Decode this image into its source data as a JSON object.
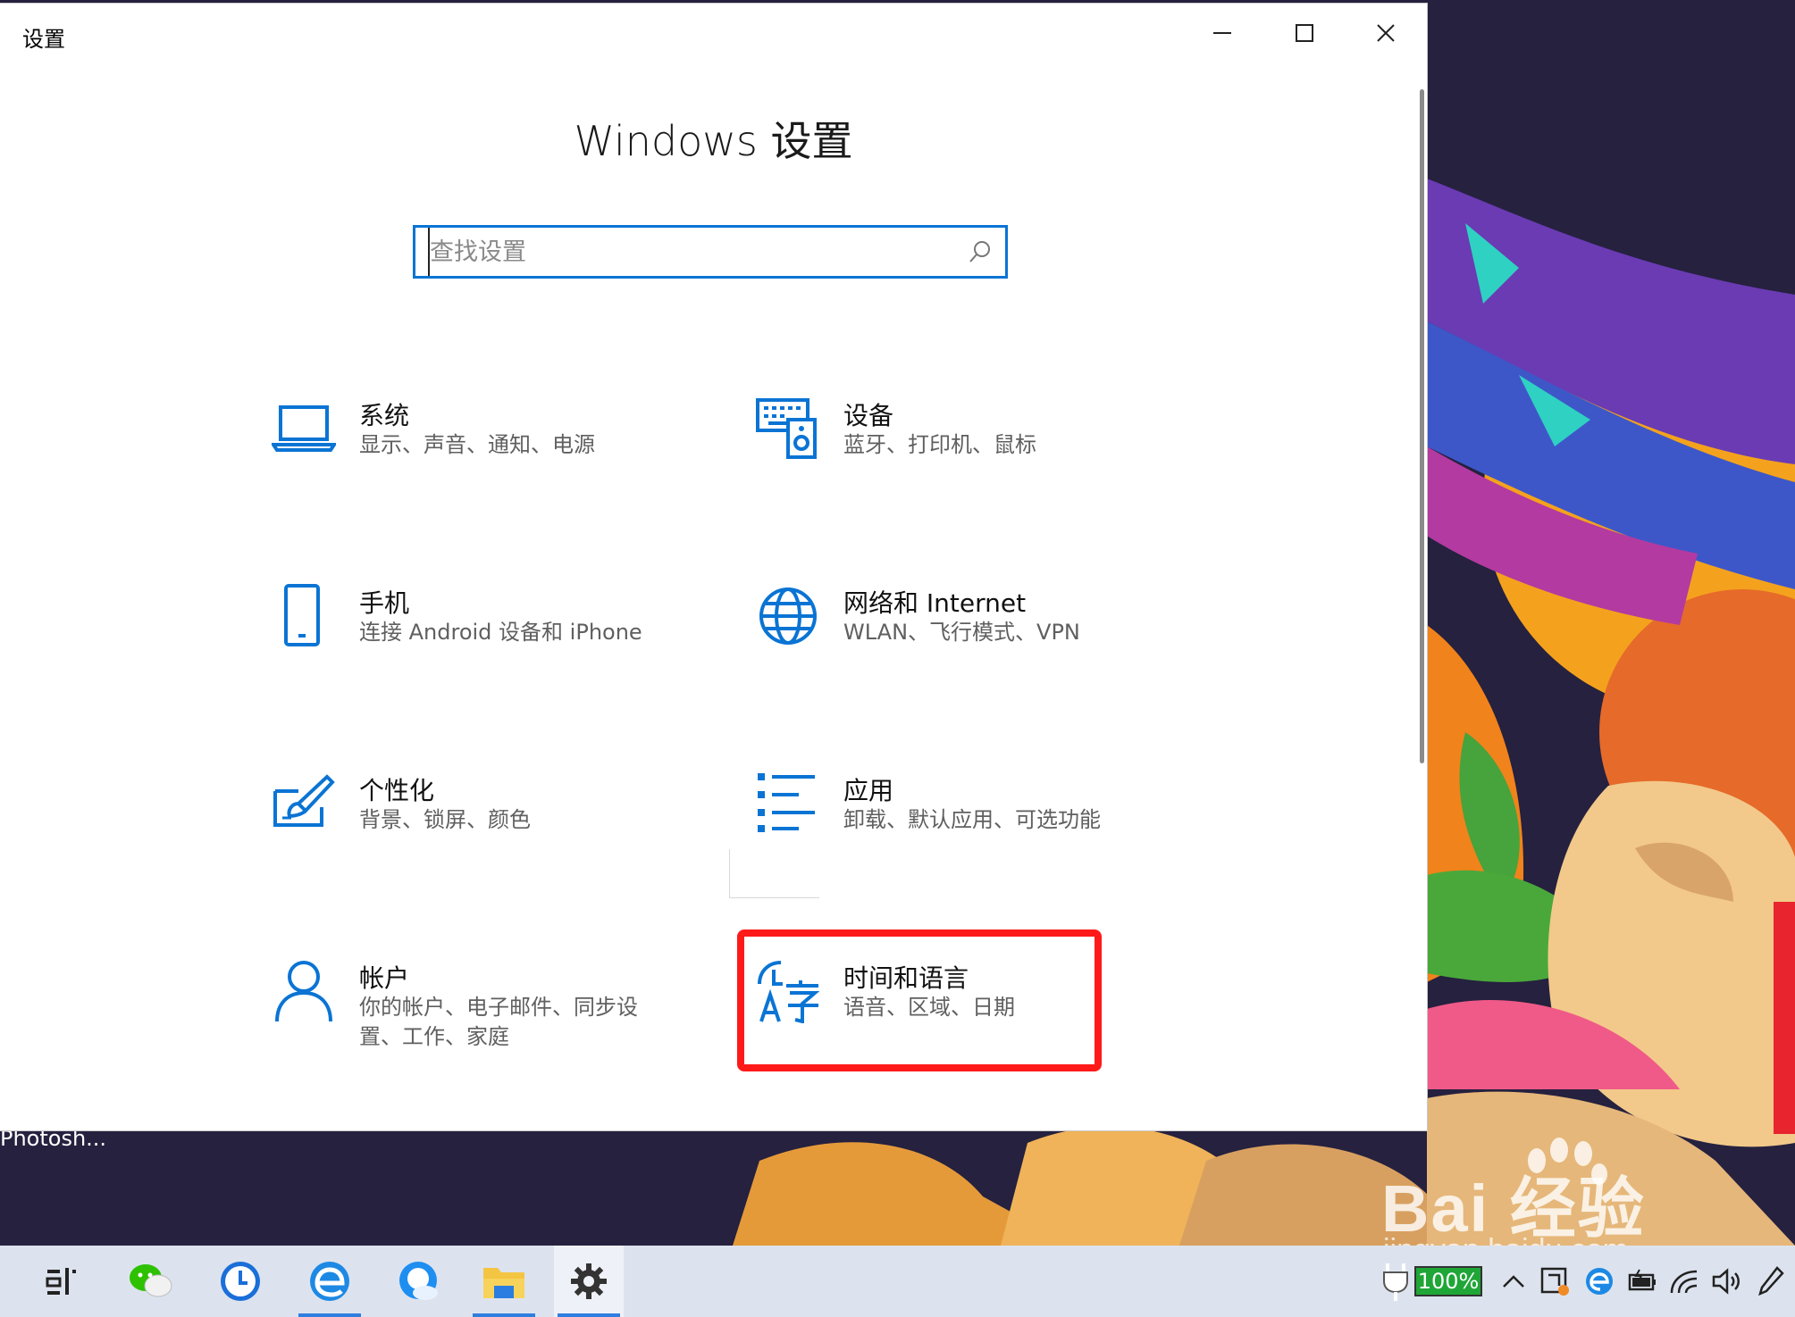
{
  "window": {
    "title": "设置",
    "heading": "Windows 设置"
  },
  "search": {
    "placeholder": "查找设置"
  },
  "tiles": [
    {
      "title": "系统",
      "desc": "显示、声音、通知、电源",
      "icon": "laptop-icon"
    },
    {
      "title": "设备",
      "desc": "蓝牙、打印机、鼠标",
      "icon": "devices-icon"
    },
    {
      "title": "手机",
      "desc": "连接 Android 设备和 iPhone",
      "icon": "phone-icon"
    },
    {
      "title": "网络和 Internet",
      "desc": "WLAN、飞行模式、VPN",
      "icon": "globe-icon"
    },
    {
      "title": "个性化",
      "desc": "背景、锁屏、颜色",
      "icon": "paintbrush-icon"
    },
    {
      "title": "应用",
      "desc": "卸载、默认应用、可选功能",
      "icon": "apps-list-icon"
    },
    {
      "title": "帐户",
      "desc": "你的帐户、电子邮件、同步设置、工作、家庭",
      "icon": "person-icon"
    },
    {
      "title": "时间和语言",
      "desc": "语音、区域、日期",
      "icon": "time-language-icon"
    }
  ],
  "desktop": {
    "photoshop_label": "Photosh...",
    "watermark_main": "Bai 经验",
    "watermark_sub": "jingyan.baidu.com"
  },
  "taskbar": {
    "items": [
      "task-view-icon",
      "wechat-icon",
      "blue-clock-app-icon",
      "edge-icon",
      "browser-icon",
      "file-explorer-icon",
      "settings-icon"
    ],
    "battery": "100%"
  },
  "colors": {
    "accent": "#0a74d4",
    "highlight": "#ff1a1a",
    "taskbar": "#dde3ee"
  }
}
